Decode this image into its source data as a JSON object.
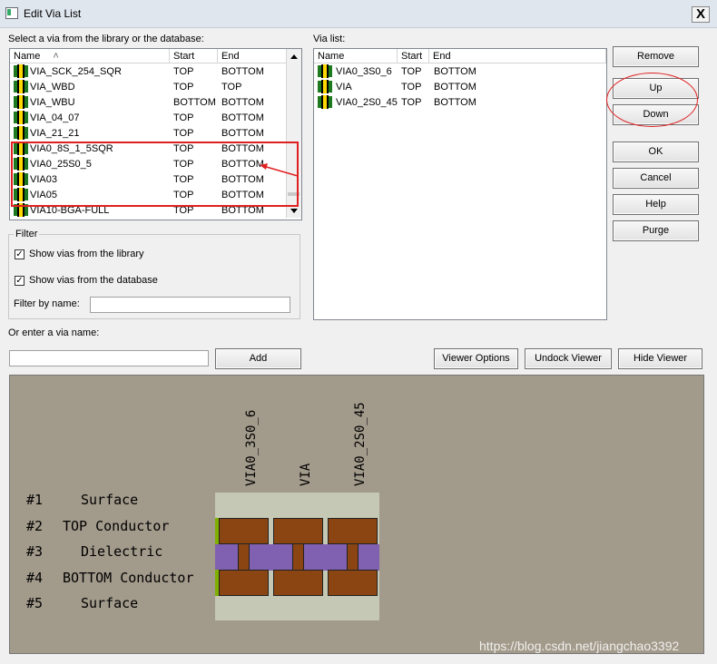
{
  "window": {
    "title": "Edit Via List",
    "close_glyph": "X"
  },
  "library": {
    "label": "Select a via from the library or the database:",
    "columns": [
      "Name",
      "Start",
      "End"
    ],
    "rows": [
      {
        "name": "VIA_SCK_254_SQR",
        "start": "TOP",
        "end": "BOTTOM"
      },
      {
        "name": "VIA_WBD",
        "start": "TOP",
        "end": "TOP"
      },
      {
        "name": "VIA_WBU",
        "start": "BOTTOM",
        "end": "BOTTOM"
      },
      {
        "name": "VIA_04_07",
        "start": "TOP",
        "end": "BOTTOM"
      },
      {
        "name": "VIA_21_21",
        "start": "TOP",
        "end": "BOTTOM"
      },
      {
        "name": "VIA0_8S_1_5SQR",
        "start": "TOP",
        "end": "BOTTOM"
      },
      {
        "name": "VIA0_25S0_5",
        "start": "TOP",
        "end": "BOTTOM"
      },
      {
        "name": "VIA03",
        "start": "TOP",
        "end": "BOTTOM"
      },
      {
        "name": "VIA05",
        "start": "TOP",
        "end": "BOTTOM"
      },
      {
        "name": "VIA10-BGA-FULL",
        "start": "TOP",
        "end": "BOTTOM"
      }
    ]
  },
  "via_list": {
    "label": "Via list:",
    "columns": [
      "Name",
      "Start",
      "End"
    ],
    "rows": [
      {
        "name": "VIA0_3S0_6",
        "start": "TOP",
        "end": "BOTTOM"
      },
      {
        "name": "VIA",
        "start": "TOP",
        "end": "BOTTOM"
      },
      {
        "name": "VIA0_2S0_45",
        "start": "TOP",
        "end": "BOTTOM"
      }
    ]
  },
  "buttons": {
    "remove": "Remove",
    "up": "Up",
    "down": "Down",
    "ok": "OK",
    "cancel": "Cancel",
    "help": "Help",
    "purge": "Purge",
    "add": "Add",
    "viewer_options": "Viewer Options",
    "undock_viewer": "Undock Viewer",
    "hide_viewer": "Hide Viewer"
  },
  "filter": {
    "title": "Filter",
    "show_library": "Show vias from the library",
    "show_library_checked": true,
    "show_database": "Show vias from the database",
    "show_database_checked": true,
    "by_name_label": "Filter by name:",
    "by_name_value": ""
  },
  "enter_via": {
    "label": "Or enter a via name:",
    "value": ""
  },
  "viewer": {
    "via_names": [
      "VIA0_3S0_6",
      "VIA",
      "VIA0_2S0_45"
    ],
    "layers": [
      {
        "num": "#1",
        "name": "Surface"
      },
      {
        "num": "#2",
        "name": "TOP Conductor"
      },
      {
        "num": "#3",
        "name": "Dielectric"
      },
      {
        "num": "#4",
        "name": "BOTTOM Conductor"
      },
      {
        "num": "#5",
        "name": "Surface"
      }
    ],
    "colors": {
      "background": "#a29a8b",
      "surface": "#c4c8b4",
      "conductor": "#8b4513",
      "dielectric": "#8060b0",
      "drill": "#8b4513",
      "pad_edge": "#7fb000"
    }
  },
  "annotations": {
    "highlight_color": "#e02020",
    "check_glyph": "✓"
  },
  "watermark": "https://blog.csdn.net/jiangchao3392"
}
